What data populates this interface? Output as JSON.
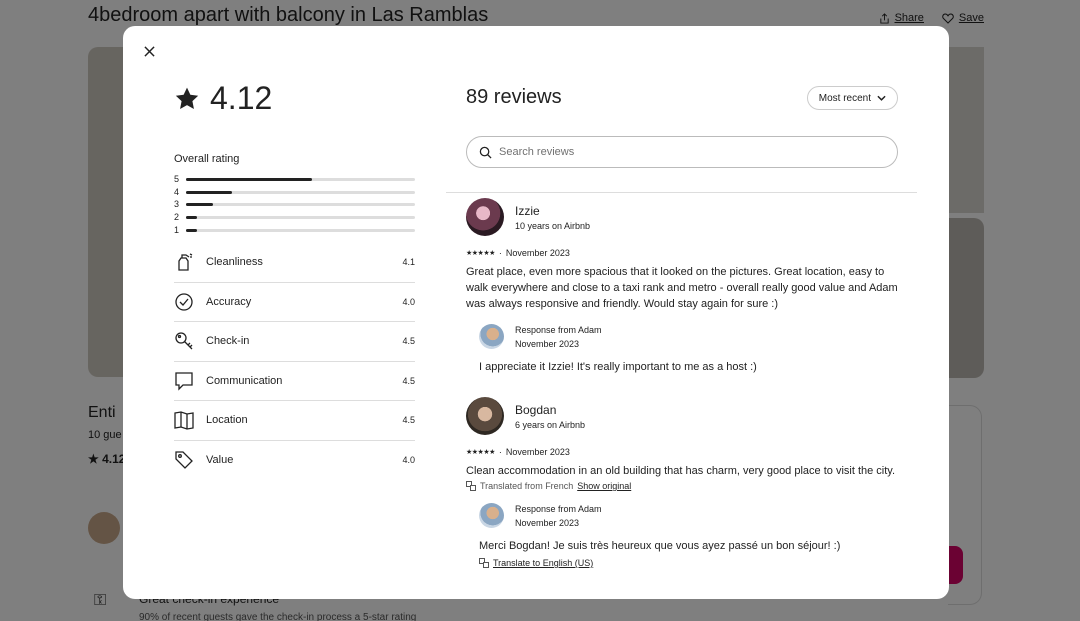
{
  "background": {
    "title": "4bedroom apart with balcony in Las Ramblas",
    "share_label": "Share",
    "save_label": "Save",
    "listing_type": "Enti",
    "guests": "10 gue",
    "rating_short": "4.12",
    "highlight_title": "Great check-in experience",
    "highlight_sub": "90% of recent guests gave the check-in process a 5-star rating"
  },
  "modal": {
    "overall_value": "4.12",
    "overall_label": "Overall rating",
    "histogram": [
      {
        "stars": "5",
        "fraction": 0.55
      },
      {
        "stars": "4",
        "fraction": 0.2
      },
      {
        "stars": "3",
        "fraction": 0.12
      },
      {
        "stars": "2",
        "fraction": 0.05
      },
      {
        "stars": "1",
        "fraction": 0.05
      }
    ],
    "categories": [
      {
        "name": "Cleanliness",
        "score": "4.1",
        "icon": "spray-bottle-icon"
      },
      {
        "name": "Accuracy",
        "score": "4.0",
        "icon": "check-circle-icon"
      },
      {
        "name": "Check-in",
        "score": "4.5",
        "icon": "key-icon"
      },
      {
        "name": "Communication",
        "score": "4.5",
        "icon": "chat-bubble-icon"
      },
      {
        "name": "Location",
        "score": "4.5",
        "icon": "map-icon"
      },
      {
        "name": "Value",
        "score": "4.0",
        "icon": "tag-icon"
      }
    ],
    "review_count": "89 reviews",
    "sort_label": "Most recent",
    "search_placeholder": "Search reviews",
    "reviews": [
      {
        "name": "Izzie",
        "tenure": "10 years on Airbnb",
        "stars": "★★★★★",
        "date": "November 2023",
        "text": "Great place, even more spacious that it looked on the pictures. Great location, easy to walk everywhere and close to a taxi rank and metro - overall really good value and Adam was always responsive and friendly. Would stay again for sure :)",
        "response_from": "Response from Adam",
        "response_date": "November 2023",
        "response_text": "I appreciate it Izzie! It's really important to me as a host :)"
      },
      {
        "name": "Bogdan",
        "tenure": "6 years on Airbnb",
        "stars": "★★★★★",
        "date": "November 2023",
        "text": "Clean accommodation in an old building that has charm, very good place to visit the city.",
        "translated_label": "Translated from French",
        "show_original": "Show original",
        "response_from": "Response from Adam",
        "response_date": "November 2023",
        "response_text": "Merci Bogdan! Je suis très heureux que vous ayez passé un bon séjour! :)",
        "translate_link": "Translate to English (US)"
      }
    ]
  }
}
